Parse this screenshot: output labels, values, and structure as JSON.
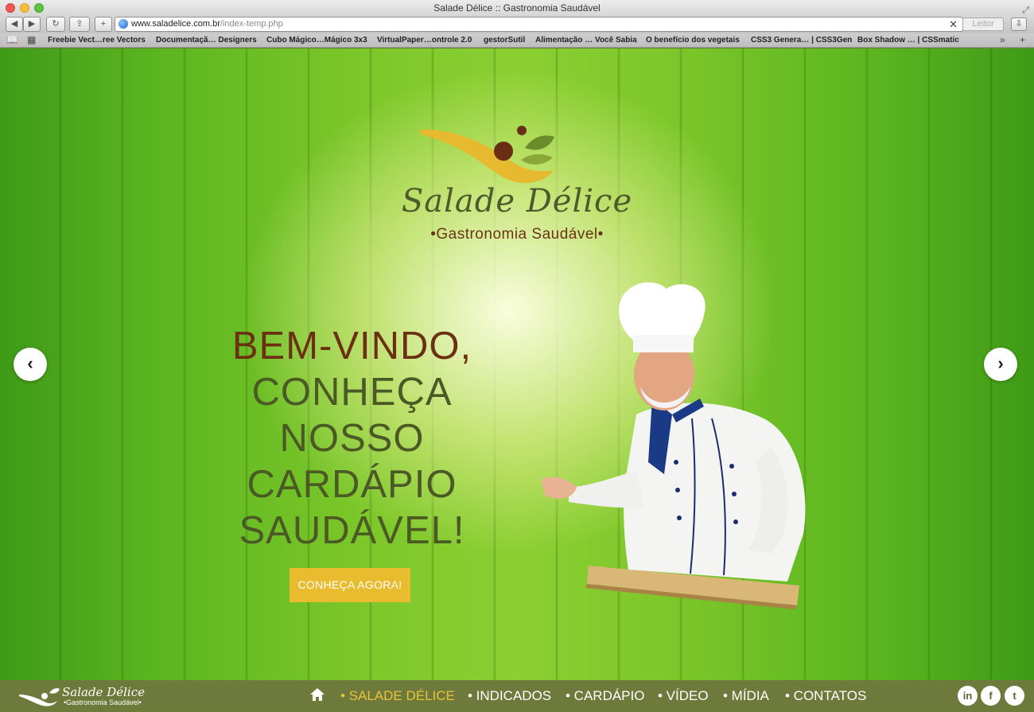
{
  "browser": {
    "title": "Salade Délice :: Gastronomia Saudável",
    "url_domain": "www.saladelice.com.br",
    "url_path": "/index-temp.php",
    "reader_label": "Leitor",
    "bookmarks": [
      "Freebie Vect…ree Vectors",
      "Documentaçã… Designers",
      "Cubo Mágico…Mágico 3x3",
      "VirtualPaper…ontrole 2.0",
      "gestorSutil",
      "Alimentação … Você Sabia",
      "O benefício dos vegetais",
      "CSS3 Genera… | CSS3Gen",
      "Box Shadow … | CSSmatic"
    ]
  },
  "hero": {
    "logo_name": "Salade Délice",
    "logo_tagline": "•Gastronomia Saudável•",
    "headline": [
      "BEM-VINDO,",
      "CONHEÇA",
      "NOSSO",
      "CARDÁPIO",
      "SAUDÁVEL!"
    ],
    "cta_label": "CONHEÇA AGORA!",
    "prev_icon": "chevron-left-icon",
    "next_icon": "chevron-right-icon"
  },
  "nav": {
    "logo_name": "Salade Délice",
    "logo_tagline": "•Gastronomia Saudável•",
    "items": [
      "• SALADE DÉLICE",
      "• INDICADOS",
      "• CARDÁPIO",
      "• VÍDEO",
      "• MÍDIA",
      "• CONTATOS"
    ],
    "active_index": 0,
    "social": [
      "in",
      "f",
      "t"
    ]
  },
  "colors": {
    "accent_yellow": "#e8bc2e",
    "nav_bg": "#6e7a3b",
    "headline_brown": "#6b2f12",
    "headline_olive": "#4b5a25"
  }
}
